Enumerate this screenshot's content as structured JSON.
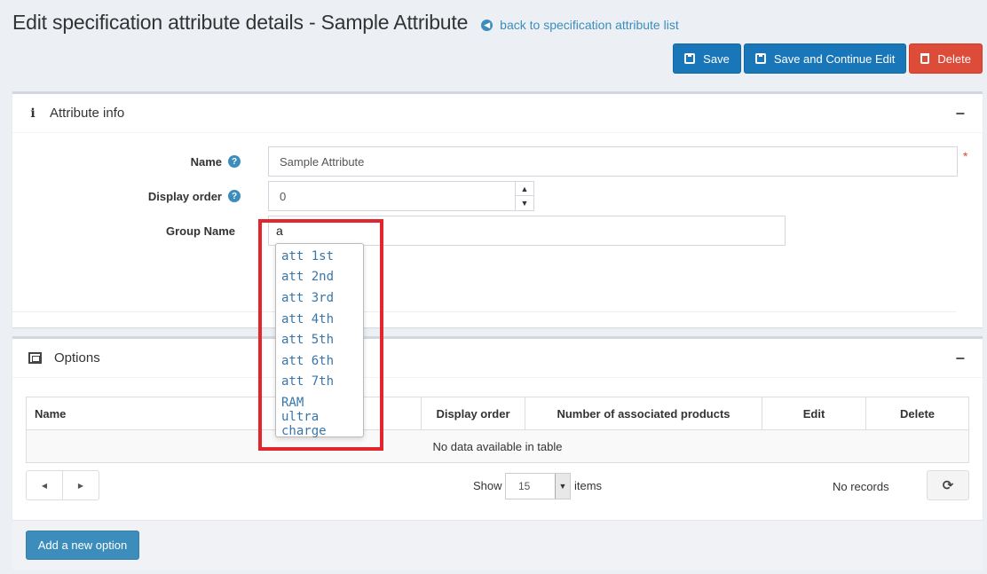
{
  "header": {
    "title": "Edit specification attribute details - Sample Attribute",
    "back_link": "back to specification attribute list"
  },
  "toolbar": {
    "save_label": "Save",
    "save_continue_label": "Save and Continue Edit",
    "delete_label": "Delete"
  },
  "attribute_info": {
    "title": "Attribute info",
    "collapse": "−",
    "name_label": "Name",
    "name_value": "Sample Attribute",
    "required_mark": "*",
    "display_order_label": "Display order",
    "display_order_value": "0",
    "group_name_label": "Group Name",
    "group_name_value": "a",
    "help_glyph": "?",
    "spin_up": "▲",
    "spin_down": "▼",
    "suggestions": [
      "att 1st",
      "att 2nd",
      "att 3rd",
      "att 4th",
      "att 5th",
      "att 6th",
      "att 7th",
      "RAM",
      "ultra charge"
    ]
  },
  "options": {
    "title": "Options",
    "collapse": "−",
    "columns": [
      "Name",
      "Display order",
      "Number of associated products",
      "Edit",
      "Delete"
    ],
    "empty_message": "No data available in table",
    "pager_prev": "◀",
    "pager_next": "▶",
    "show_label": "Show",
    "page_size": "15",
    "page_size_arrow": "▼",
    "items_label": "items",
    "records_label": "No records",
    "refresh_glyph": "⟳",
    "add_button": "Add a new option"
  },
  "icons": {
    "back": "arrow-left-circle-icon",
    "info": "info-icon",
    "options": "options-image-icon",
    "save": "save-icon",
    "delete": "trash-icon"
  },
  "colors": {
    "primary": "#1977b9",
    "danger": "#dd4b39",
    "link": "#3c8dbc",
    "highlight": "#e3262e"
  }
}
